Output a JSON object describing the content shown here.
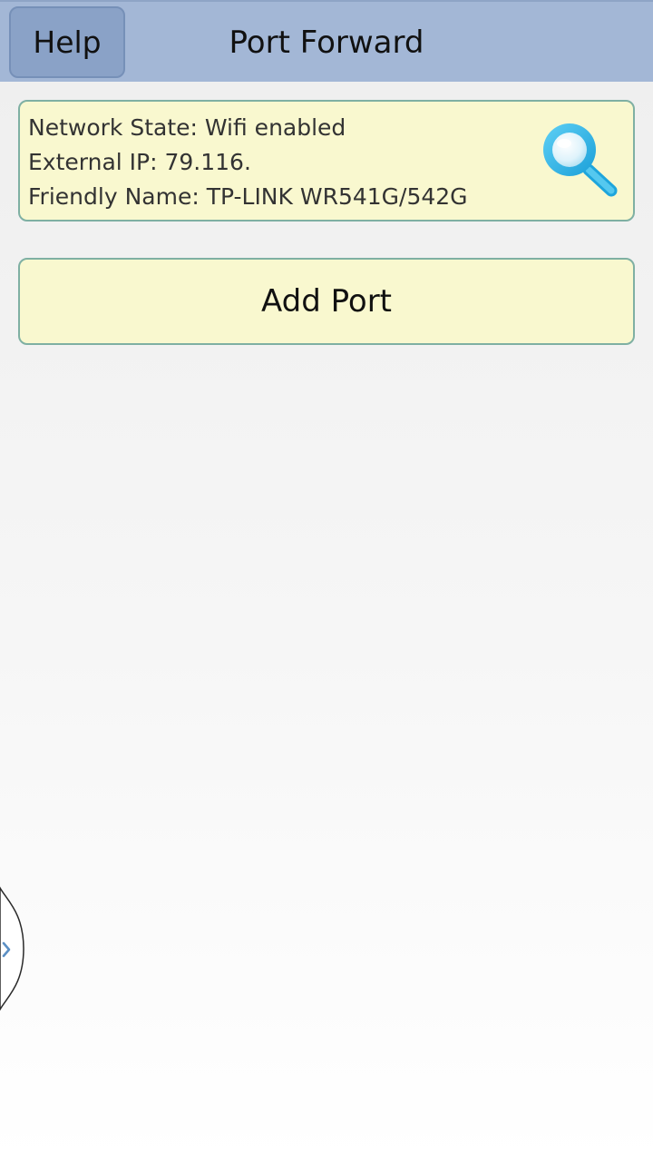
{
  "header": {
    "help_label": "Help",
    "title": "Port Forward"
  },
  "network_info": {
    "network_state": "Network State: Wifi enabled",
    "external_ip": "External IP: 79.116.",
    "friendly_name": "Friendly Name: TP-LINK WR541G/542G"
  },
  "actions": {
    "add_port_label": "Add Port"
  },
  "icons": {
    "scan": "search-icon",
    "drawer": "chevron-right-icon"
  },
  "colors": {
    "title_bar": "#a3b7d6",
    "help_button": "#8aa2c7",
    "panel_background": "#f9f8cf",
    "panel_border": "#7fb0a3",
    "search_icon": "#29b6e8"
  }
}
